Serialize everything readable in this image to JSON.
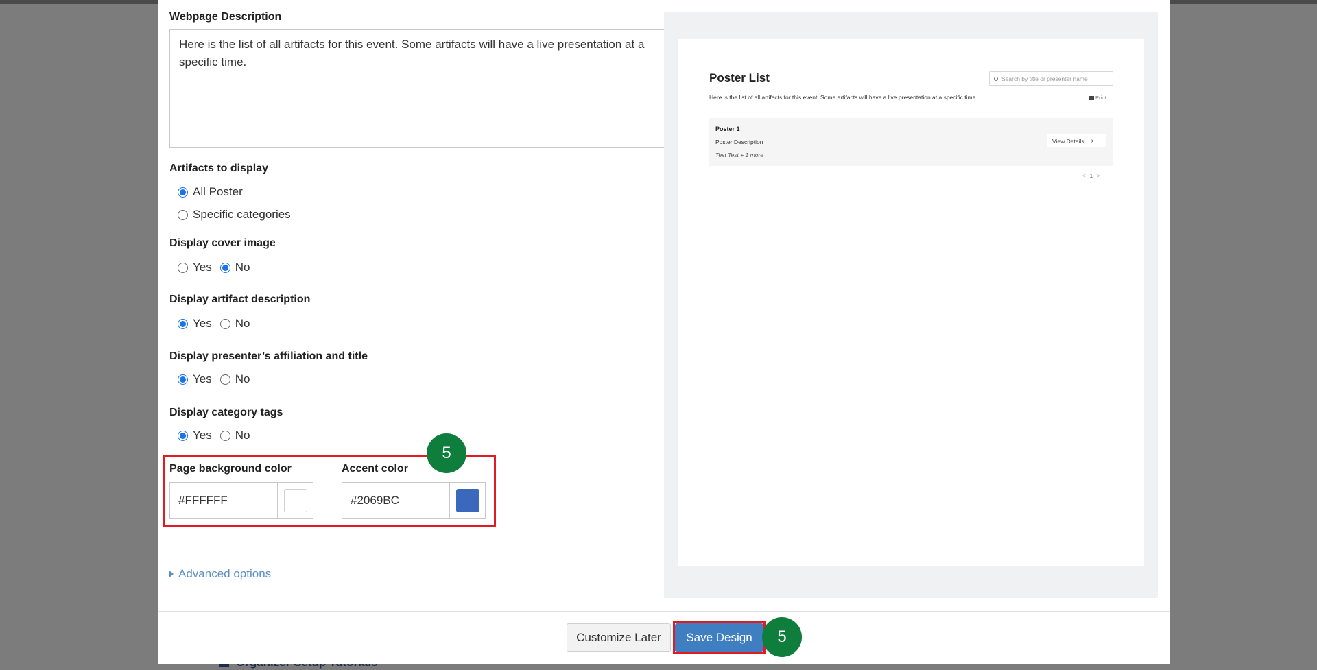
{
  "background": {
    "behind_link": "Organizer Setup Tutorials"
  },
  "form": {
    "webpage_description": {
      "label": "Webpage Description",
      "value": "Here is the list of all artifacts for this event. Some artifacts will have a live presentation at a specific time."
    },
    "artifacts_to_display": {
      "label": "Artifacts to display",
      "options": [
        "All Poster",
        "Specific categories"
      ],
      "selected": "All Poster"
    },
    "display_cover_image": {
      "label": "Display cover image",
      "yes": "Yes",
      "no": "No",
      "selected": "No"
    },
    "display_artifact_description": {
      "label": "Display artifact description",
      "yes": "Yes",
      "no": "No",
      "selected": "Yes"
    },
    "display_presenter_affiliation": {
      "label": "Display presenter’s affiliation and title",
      "yes": "Yes",
      "no": "No",
      "selected": "Yes"
    },
    "display_category_tags": {
      "label": "Display category tags",
      "yes": "Yes",
      "no": "No",
      "selected": "Yes"
    },
    "page_background_color": {
      "label": "Page background color",
      "value": "#FFFFFF",
      "swatch": "#FFFFFF"
    },
    "accent_color": {
      "label": "Accent color",
      "value": "#2069BC",
      "swatch": "#3A68BC"
    },
    "advanced_options": "Advanced options"
  },
  "annotations": {
    "colors_step": "5",
    "save_step": "5",
    "highlight_color": "#E01B24",
    "badge_color": "#0F7D3C"
  },
  "footer": {
    "customize_later": "Customize Later",
    "save_design": "Save Design"
  },
  "preview": {
    "title": "Poster List",
    "search_placeholder": "Search by title or presenter name",
    "description": "Here is the list of all artifacts for this event. Some artifacts will have a live presentation at a specific time.",
    "print": "Print",
    "card": {
      "title": "Poster 1",
      "description": "Poster Description",
      "presenters": "Test Test + 1 more",
      "button": "View Details"
    },
    "pager": {
      "prev": "<",
      "current": "1",
      "next": ">"
    }
  }
}
